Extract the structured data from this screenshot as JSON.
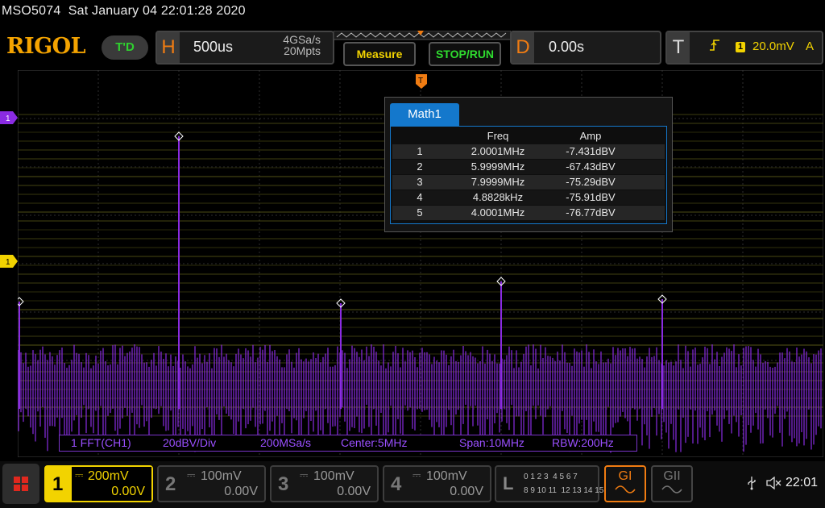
{
  "status": {
    "model": "MSO5074",
    "datetime": "Sat January 04 22:01:28 2020"
  },
  "header": {
    "brand": "RIGOL",
    "run_state": "T'D",
    "horizontal": {
      "letter": "H",
      "timebase": "500us",
      "sample_rate": "4GSa/s",
      "memory_depth": "20Mpts"
    },
    "measure_label": "Measure",
    "stop_run_label": "STOP/RUN",
    "delay": {
      "letter": "D",
      "value": "0.00s"
    },
    "trigger": {
      "letter": "T",
      "source": "1",
      "level": "20.0mV",
      "mode": "A"
    }
  },
  "math_window": {
    "tab_label": "Math1",
    "columns": {
      "freq": "Freq",
      "amp": "Amp"
    },
    "rows": [
      {
        "idx": "1",
        "freq": "2.0001MHz",
        "amp": "-7.431dBV"
      },
      {
        "idx": "2",
        "freq": "5.9999MHz",
        "amp": "-67.43dBV"
      },
      {
        "idx": "3",
        "freq": "7.9999MHz",
        "amp": "-75.29dBV"
      },
      {
        "idx": "4",
        "freq": "4.8828kHz",
        "amp": "-75.91dBV"
      },
      {
        "idx": "5",
        "freq": "4.0001MHz",
        "amp": "-76.77dBV"
      }
    ]
  },
  "fft_info": {
    "source": "1 FFT(CH1)",
    "scale": "20dBV/Div",
    "rate": "200MSa/s",
    "center": "Center:5MHz",
    "span": "Span:10MHz",
    "rbw": "RBW:200Hz"
  },
  "markers": {
    "math_marker": "1",
    "ch1_marker": "1",
    "trigger_marker": "T"
  },
  "channels": [
    {
      "num": "1",
      "scale": "200mV",
      "offset": "0.00V",
      "color": "#f2d300",
      "active": true
    },
    {
      "num": "2",
      "scale": "100mV",
      "offset": "0.00V",
      "color": "#777777",
      "active": false
    },
    {
      "num": "3",
      "scale": "100mV",
      "offset": "0.00V",
      "color": "#777777",
      "active": false
    },
    {
      "num": "4",
      "scale": "100mV",
      "offset": "0.00V",
      "color": "#777777",
      "active": false
    }
  ],
  "logic": {
    "letter": "L",
    "row1": "0 1 2 3  4 5 6 7",
    "row2": "8 9 10 11  12 13 14 15"
  },
  "generators": {
    "g1": "GI",
    "g2": "GII"
  },
  "system": {
    "time": "22:01"
  },
  "colors": {
    "accent": "#f07c12",
    "ch1": "#f2d300",
    "math": "#8a2be2",
    "link": "#1478cc"
  }
}
